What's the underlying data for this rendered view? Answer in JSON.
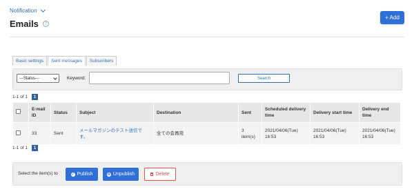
{
  "breadcrumb": {
    "label": "Notification"
  },
  "page": {
    "title": "Emails"
  },
  "actions": {
    "add_label": "+ Add"
  },
  "tabs": [
    {
      "label": "Basic settings"
    },
    {
      "label": "Sent messages"
    },
    {
      "label": "Subscribers"
    }
  ],
  "filter": {
    "status_selected": "---Status---",
    "keyword_label": "Keyword:",
    "keyword_value": "",
    "search_label": "Search"
  },
  "pagination": {
    "summary": "1-1 of 1",
    "current_page": "1"
  },
  "table": {
    "headers": {
      "email_id": "E-mail ID",
      "status": "Status",
      "subject": "Subject",
      "destination": "Destination",
      "sent": "Sent",
      "scheduled": "Scheduled delivery time",
      "start": "Delivery start time",
      "end": "Delivery end time"
    },
    "rows": [
      {
        "email_id": "33",
        "status": "Sent",
        "subject": "メールマガジンのテスト送信です。",
        "destination": "全ての会員宛",
        "sent": "3 item(s)",
        "scheduled": "2021/04/06(Tue) 16:53",
        "start": "2021/04/06(Tue) 16:53",
        "end": "2021/04/06(Tue) 16:53"
      }
    ]
  },
  "bulk": {
    "label": "Select the item(s) to",
    "publish_label": "Publish",
    "unpublish_label": "Unpublish",
    "delete_label": "Delete"
  },
  "colors": {
    "accent": "#2f6fd6",
    "link": "#2f6fb3",
    "danger": "#d9534f",
    "page_badge": "#2f5f9e"
  }
}
